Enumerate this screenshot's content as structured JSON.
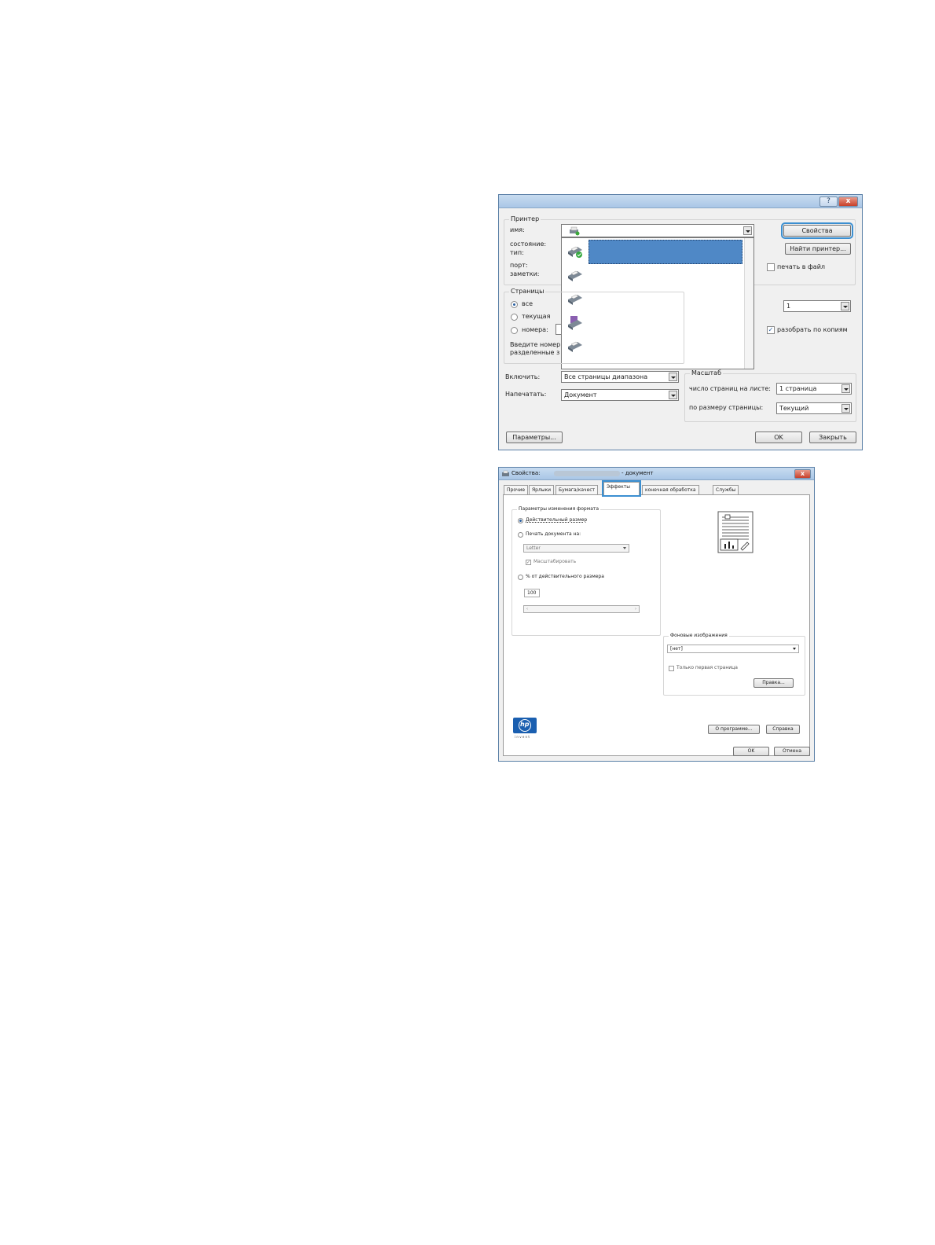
{
  "print_dialog": {
    "help_label": "?",
    "close_label": "x",
    "printer_group": "Принтер",
    "name_label": "имя:",
    "status_label": "состояние:",
    "type_label": "тип:",
    "port_label": "порт:",
    "notes_label": "заметки:",
    "properties_button": "Свойства",
    "find_printer_button": "Найти принтер...",
    "print_to_file_label": "печать в файл",
    "pages_group": "Страницы",
    "all_label": "все",
    "current_label": "текущая",
    "numbers_label": "номера:",
    "hint_line1": "Введите номер",
    "hint_line2": "разделенные з",
    "copies_value": "1",
    "collate_label": "разобрать по копиям",
    "include_label": "Включить:",
    "include_value": "Все страницы диапазона",
    "print_what_label": "Напечатать:",
    "print_what_value": "Документ",
    "scale_group": "Масштаб",
    "pages_per_sheet_label": "число страниц на листе:",
    "pages_per_sheet_value": "1 страница",
    "fit_to_label": "по размеру страницы:",
    "fit_to_value": "Текущий",
    "options_button": "Параметры...",
    "ok_button": "OK",
    "close_button": "Закрыть"
  },
  "props_dialog": {
    "title_prefix": "Свойства:",
    "title_suffix": "- документ",
    "close_label": "x",
    "tabs": [
      {
        "label": "Прочие"
      },
      {
        "label": "Ярлыки"
      },
      {
        "label": "Бумага/качест"
      },
      {
        "label": "Эффекты"
      },
      {
        "label": "конечная обработка"
      },
      {
        "label": "Службы"
      }
    ],
    "resize_group": "Параметры изменения формата",
    "actual_size_label": "Действительный размер",
    "print_on_label": "Печать документа на:",
    "paper_value": "Letter",
    "scale_label": "Масштабировать",
    "percent_label": "% от действительного размера",
    "percent_value": "100",
    "watermark_group": "Фоновые изображения",
    "watermark_value": "[нет]",
    "first_page_only_label": "Только первая страница",
    "edit_button": "Правка...",
    "about_button": "О программе...",
    "help_button": "Справка",
    "ok_button": "OK",
    "cancel_button": "Отмена",
    "logo_text": "hp",
    "invent_text": "i n v e n t"
  }
}
